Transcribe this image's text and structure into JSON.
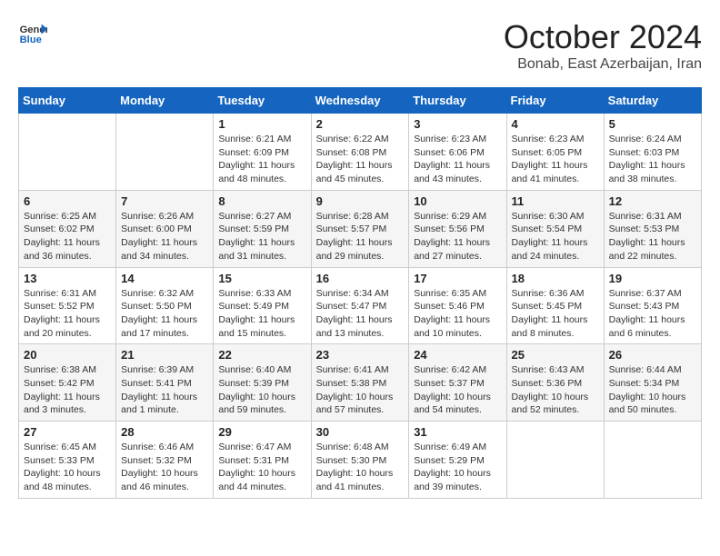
{
  "header": {
    "logo_line1": "General",
    "logo_line2": "Blue",
    "month": "October 2024",
    "location": "Bonab, East Azerbaijan, Iran"
  },
  "weekdays": [
    "Sunday",
    "Monday",
    "Tuesday",
    "Wednesday",
    "Thursday",
    "Friday",
    "Saturday"
  ],
  "weeks": [
    [
      {
        "day": "",
        "info": ""
      },
      {
        "day": "",
        "info": ""
      },
      {
        "day": "1",
        "info": "Sunrise: 6:21 AM\nSunset: 6:09 PM\nDaylight: 11 hours and 48 minutes."
      },
      {
        "day": "2",
        "info": "Sunrise: 6:22 AM\nSunset: 6:08 PM\nDaylight: 11 hours and 45 minutes."
      },
      {
        "day": "3",
        "info": "Sunrise: 6:23 AM\nSunset: 6:06 PM\nDaylight: 11 hours and 43 minutes."
      },
      {
        "day": "4",
        "info": "Sunrise: 6:23 AM\nSunset: 6:05 PM\nDaylight: 11 hours and 41 minutes."
      },
      {
        "day": "5",
        "info": "Sunrise: 6:24 AM\nSunset: 6:03 PM\nDaylight: 11 hours and 38 minutes."
      }
    ],
    [
      {
        "day": "6",
        "info": "Sunrise: 6:25 AM\nSunset: 6:02 PM\nDaylight: 11 hours and 36 minutes."
      },
      {
        "day": "7",
        "info": "Sunrise: 6:26 AM\nSunset: 6:00 PM\nDaylight: 11 hours and 34 minutes."
      },
      {
        "day": "8",
        "info": "Sunrise: 6:27 AM\nSunset: 5:59 PM\nDaylight: 11 hours and 31 minutes."
      },
      {
        "day": "9",
        "info": "Sunrise: 6:28 AM\nSunset: 5:57 PM\nDaylight: 11 hours and 29 minutes."
      },
      {
        "day": "10",
        "info": "Sunrise: 6:29 AM\nSunset: 5:56 PM\nDaylight: 11 hours and 27 minutes."
      },
      {
        "day": "11",
        "info": "Sunrise: 6:30 AM\nSunset: 5:54 PM\nDaylight: 11 hours and 24 minutes."
      },
      {
        "day": "12",
        "info": "Sunrise: 6:31 AM\nSunset: 5:53 PM\nDaylight: 11 hours and 22 minutes."
      }
    ],
    [
      {
        "day": "13",
        "info": "Sunrise: 6:31 AM\nSunset: 5:52 PM\nDaylight: 11 hours and 20 minutes."
      },
      {
        "day": "14",
        "info": "Sunrise: 6:32 AM\nSunset: 5:50 PM\nDaylight: 11 hours and 17 minutes."
      },
      {
        "day": "15",
        "info": "Sunrise: 6:33 AM\nSunset: 5:49 PM\nDaylight: 11 hours and 15 minutes."
      },
      {
        "day": "16",
        "info": "Sunrise: 6:34 AM\nSunset: 5:47 PM\nDaylight: 11 hours and 13 minutes."
      },
      {
        "day": "17",
        "info": "Sunrise: 6:35 AM\nSunset: 5:46 PM\nDaylight: 11 hours and 10 minutes."
      },
      {
        "day": "18",
        "info": "Sunrise: 6:36 AM\nSunset: 5:45 PM\nDaylight: 11 hours and 8 minutes."
      },
      {
        "day": "19",
        "info": "Sunrise: 6:37 AM\nSunset: 5:43 PM\nDaylight: 11 hours and 6 minutes."
      }
    ],
    [
      {
        "day": "20",
        "info": "Sunrise: 6:38 AM\nSunset: 5:42 PM\nDaylight: 11 hours and 3 minutes."
      },
      {
        "day": "21",
        "info": "Sunrise: 6:39 AM\nSunset: 5:41 PM\nDaylight: 11 hours and 1 minute."
      },
      {
        "day": "22",
        "info": "Sunrise: 6:40 AM\nSunset: 5:39 PM\nDaylight: 10 hours and 59 minutes."
      },
      {
        "day": "23",
        "info": "Sunrise: 6:41 AM\nSunset: 5:38 PM\nDaylight: 10 hours and 57 minutes."
      },
      {
        "day": "24",
        "info": "Sunrise: 6:42 AM\nSunset: 5:37 PM\nDaylight: 10 hours and 54 minutes."
      },
      {
        "day": "25",
        "info": "Sunrise: 6:43 AM\nSunset: 5:36 PM\nDaylight: 10 hours and 52 minutes."
      },
      {
        "day": "26",
        "info": "Sunrise: 6:44 AM\nSunset: 5:34 PM\nDaylight: 10 hours and 50 minutes."
      }
    ],
    [
      {
        "day": "27",
        "info": "Sunrise: 6:45 AM\nSunset: 5:33 PM\nDaylight: 10 hours and 48 minutes."
      },
      {
        "day": "28",
        "info": "Sunrise: 6:46 AM\nSunset: 5:32 PM\nDaylight: 10 hours and 46 minutes."
      },
      {
        "day": "29",
        "info": "Sunrise: 6:47 AM\nSunset: 5:31 PM\nDaylight: 10 hours and 44 minutes."
      },
      {
        "day": "30",
        "info": "Sunrise: 6:48 AM\nSunset: 5:30 PM\nDaylight: 10 hours and 41 minutes."
      },
      {
        "day": "31",
        "info": "Sunrise: 6:49 AM\nSunset: 5:29 PM\nDaylight: 10 hours and 39 minutes."
      },
      {
        "day": "",
        "info": ""
      },
      {
        "day": "",
        "info": ""
      }
    ]
  ]
}
